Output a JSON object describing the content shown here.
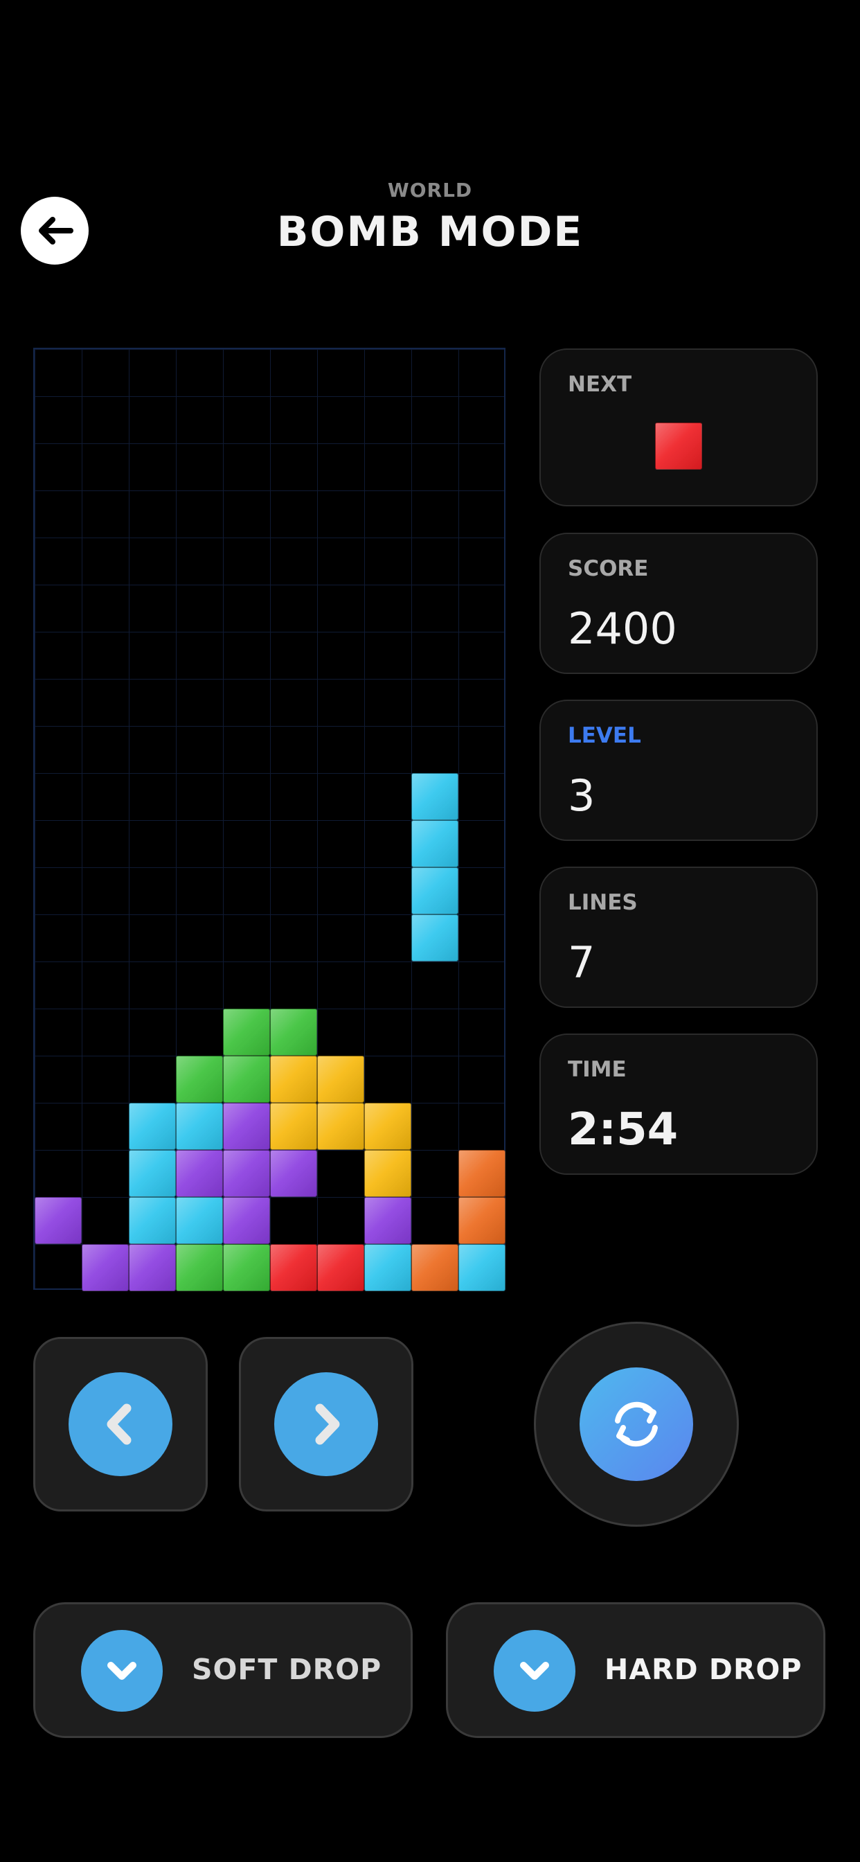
{
  "header": {
    "subtitle": "WORLD",
    "title": "BOMB MODE"
  },
  "board": {
    "columns": 10,
    "rows": 20,
    "colors": {
      "cyan": "#2ec6ee",
      "purple": "#8b3ee0",
      "green": "#3cc23a",
      "yellow": "#f7b90e",
      "red": "#ef1f24",
      "orange": "#ec6a1e"
    },
    "active_piece": {
      "color": "cyan",
      "cells": [
        [
          8,
          9
        ],
        [
          8,
          10
        ],
        [
          8,
          11
        ],
        [
          8,
          12
        ]
      ]
    },
    "locked": [
      {
        "c": 4,
        "r": 14,
        "color": "green"
      },
      {
        "c": 5,
        "r": 14,
        "color": "green"
      },
      {
        "c": 3,
        "r": 15,
        "color": "green"
      },
      {
        "c": 4,
        "r": 15,
        "color": "green"
      },
      {
        "c": 5,
        "r": 15,
        "color": "yellow"
      },
      {
        "c": 6,
        "r": 15,
        "color": "yellow"
      },
      {
        "c": 2,
        "r": 16,
        "color": "cyan"
      },
      {
        "c": 3,
        "r": 16,
        "color": "cyan"
      },
      {
        "c": 4,
        "r": 16,
        "color": "purple"
      },
      {
        "c": 5,
        "r": 16,
        "color": "yellow"
      },
      {
        "c": 6,
        "r": 16,
        "color": "yellow"
      },
      {
        "c": 7,
        "r": 16,
        "color": "yellow"
      },
      {
        "c": 2,
        "r": 17,
        "color": "cyan"
      },
      {
        "c": 3,
        "r": 17,
        "color": "purple"
      },
      {
        "c": 4,
        "r": 17,
        "color": "purple"
      },
      {
        "c": 5,
        "r": 17,
        "color": "purple"
      },
      {
        "c": 7,
        "r": 17,
        "color": "yellow"
      },
      {
        "c": 9,
        "r": 17,
        "color": "orange"
      },
      {
        "c": 0,
        "r": 18,
        "color": "purple"
      },
      {
        "c": 2,
        "r": 18,
        "color": "cyan"
      },
      {
        "c": 3,
        "r": 18,
        "color": "cyan"
      },
      {
        "c": 4,
        "r": 18,
        "color": "purple"
      },
      {
        "c": 7,
        "r": 18,
        "color": "purple"
      },
      {
        "c": 9,
        "r": 18,
        "color": "orange"
      },
      {
        "c": 1,
        "r": 19,
        "color": "purple"
      },
      {
        "c": 2,
        "r": 19,
        "color": "purple"
      },
      {
        "c": 3,
        "r": 19,
        "color": "green"
      },
      {
        "c": 4,
        "r": 19,
        "color": "green"
      },
      {
        "c": 5,
        "r": 19,
        "color": "red"
      },
      {
        "c": 6,
        "r": 19,
        "color": "red"
      },
      {
        "c": 7,
        "r": 19,
        "color": "cyan"
      },
      {
        "c": 8,
        "r": 19,
        "color": "orange"
      },
      {
        "c": 9,
        "r": 19,
        "color": "cyan"
      }
    ]
  },
  "stats": {
    "next_label": "NEXT",
    "next_piece_color": "red",
    "score_label": "SCORE",
    "score_value": "2400",
    "level_label": "LEVEL",
    "level_value": "3",
    "level_label_color": "#3d7bf0",
    "lines_label": "LINES",
    "lines_value": "7",
    "time_label": "TIME",
    "time_value": "2:54"
  },
  "controls": {
    "left_icon": "chevron-left-icon",
    "right_icon": "chevron-right-icon",
    "rotate_icon": "rotate-icon",
    "soft_drop_label": "SOFT DROP",
    "hard_drop_label": "HARD DROP",
    "drop_icon": "chevron-down-icon",
    "accent_color": "#48a8e6"
  }
}
